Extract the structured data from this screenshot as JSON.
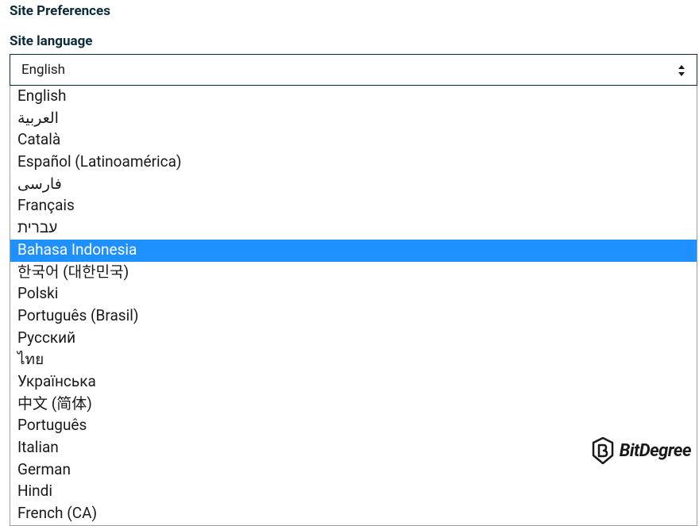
{
  "section_title": "Site Preferences",
  "language": {
    "label": "Site language",
    "selected": "English",
    "options": [
      {
        "label": "English",
        "highlighted": false
      },
      {
        "label": "العربية",
        "highlighted": false
      },
      {
        "label": "Català",
        "highlighted": false
      },
      {
        "label": "Español (Latinoamérica)",
        "highlighted": false
      },
      {
        "label": "فارسی",
        "highlighted": false
      },
      {
        "label": "Français",
        "highlighted": false
      },
      {
        "label": "עברית",
        "highlighted": false
      },
      {
        "label": "Bahasa Indonesia",
        "highlighted": true
      },
      {
        "label": "한국어 (대한민국)",
        "highlighted": false
      },
      {
        "label": "Polski",
        "highlighted": false
      },
      {
        "label": "Português (Brasil)",
        "highlighted": false
      },
      {
        "label": "Русский",
        "highlighted": false
      },
      {
        "label": "ไทย",
        "highlighted": false
      },
      {
        "label": "Українська",
        "highlighted": false
      },
      {
        "label": "中文 (简体)",
        "highlighted": false
      },
      {
        "label": "Português",
        "highlighted": false
      },
      {
        "label": "Italian",
        "highlighted": false
      },
      {
        "label": "German",
        "highlighted": false
      },
      {
        "label": "Hindi",
        "highlighted": false
      },
      {
        "label": "French (CA)",
        "highlighted": false
      }
    ]
  },
  "watermark": "BitDegree"
}
